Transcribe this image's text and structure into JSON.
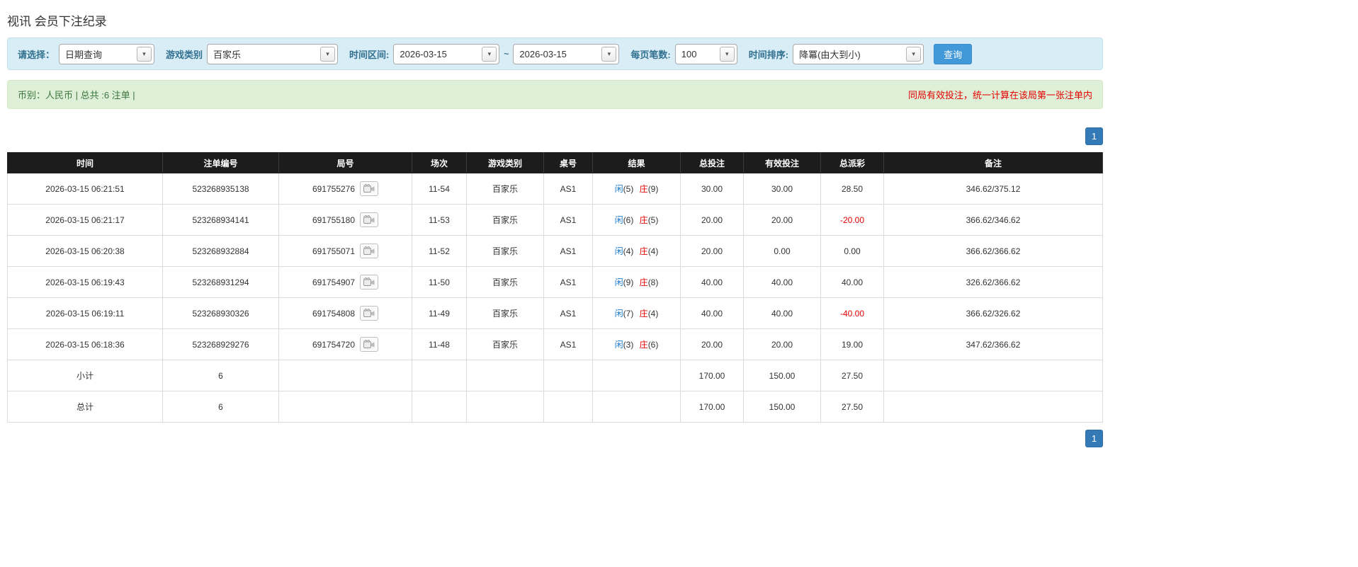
{
  "colors": {
    "accent_blue": "#1E7BCF",
    "negative_red": "#E60000",
    "table_header_bg": "#1C1C1C",
    "highlight_row": "#F8F883",
    "filter_bar_bg": "#D9EDF7",
    "summary_bar_bg": "#DFF0D8",
    "search_button_blue": "#4398D8",
    "pagination_active": "#337AB7",
    "footer_row_gray": "#9D9D9D"
  },
  "page": {
    "title": "视讯 会员下注纪录"
  },
  "filters": {
    "select_label": "请选择：",
    "select_value": "日期查询",
    "game_type_label": "游戏类别",
    "game_type_value": "百家乐",
    "range_label": "时间区间:",
    "date_from": "2026-03-15",
    "range_separator": "~",
    "date_to": "2026-03-15",
    "page_size_label": "每页笔数:",
    "page_size_value": "100",
    "sort_label": "时间排序:",
    "sort_value": "降冪(由大到小)",
    "search_button_label": "查询",
    "caret": "▾"
  },
  "summary": {
    "info": "币别：人民币 | 总共 :6 注单 |",
    "notice": "同局有效投注，统一计算在该局第一张注单内"
  },
  "pagination": {
    "current_page": "1"
  },
  "table": {
    "headers": [
      "时间",
      "注单编号",
      "局号",
      "场次",
      "游戏类别",
      "桌号",
      "结果",
      "总投注",
      "有效投注",
      "总派彩",
      "备注"
    ],
    "rows": [
      {
        "time": "2026-03-15 06:21:51",
        "bet_id": "523268935138",
        "round": "691755276",
        "session": "11-54",
        "game": "百家乐",
        "table_no": "AS1",
        "player_label": "闲",
        "player_num": "(5)",
        "banker_label": "庄",
        "banker_num": "(9)",
        "total_bet": "30.00",
        "valid_bet": "30.00",
        "payout": "28.50",
        "note": "346.62/375.12",
        "highlighted": false
      },
      {
        "time": "2026-03-15 06:21:17",
        "bet_id": "523268934141",
        "round": "691755180",
        "session": "11-53",
        "game": "百家乐",
        "table_no": "AS1",
        "player_label": "闲",
        "player_num": "(6)",
        "banker_label": "庄",
        "banker_num": "(5)",
        "total_bet": "20.00",
        "valid_bet": "20.00",
        "payout": "-20.00",
        "note": "366.62/346.62",
        "highlighted": false
      },
      {
        "time": "2026-03-15 06:20:38",
        "bet_id": "523268932884",
        "round": "691755071",
        "session": "11-52",
        "game": "百家乐",
        "table_no": "AS1",
        "player_label": "闲",
        "player_num": "(4)",
        "banker_label": "庄",
        "banker_num": "(4)",
        "total_bet": "20.00",
        "valid_bet": "0.00",
        "payout": "0.00",
        "note": "366.62/366.62",
        "highlighted": false
      },
      {
        "time": "2026-03-15 06:19:43",
        "bet_id": "523268931294",
        "round": "691754907",
        "session": "11-50",
        "game": "百家乐",
        "table_no": "AS1",
        "player_label": "闲",
        "player_num": "(9)",
        "banker_label": "庄",
        "banker_num": "(8)",
        "total_bet": "40.00",
        "valid_bet": "40.00",
        "payout": "40.00",
        "note": "326.62/366.62",
        "highlighted": false
      },
      {
        "time": "2026-03-15 06:19:11",
        "bet_id": "523268930326",
        "round": "691754808",
        "session": "11-49",
        "game": "百家乐",
        "table_no": "AS1",
        "player_label": "闲",
        "player_num": "(7)",
        "banker_label": "庄",
        "banker_num": "(4)",
        "total_bet": "40.00",
        "valid_bet": "40.00",
        "payout": "-40.00",
        "note": "366.62/326.62",
        "highlighted": true
      },
      {
        "time": "2026-03-15 06:18:36",
        "bet_id": "523268929276",
        "round": "691754720",
        "session": "11-48",
        "game": "百家乐",
        "table_no": "AS1",
        "player_label": "闲",
        "player_num": "(3)",
        "banker_label": "庄",
        "banker_num": "(6)",
        "total_bet": "20.00",
        "valid_bet": "20.00",
        "payout": "19.00",
        "note": "347.62/366.62",
        "highlighted": false
      }
    ],
    "subtotal": {
      "label": "小计",
      "count": "6",
      "total_bet": "170.00",
      "valid_bet": "150.00",
      "payout": "27.50"
    },
    "total": {
      "label": "总计",
      "count": "6",
      "total_bet": "170.00",
      "valid_bet": "150.00",
      "payout": "27.50"
    }
  }
}
